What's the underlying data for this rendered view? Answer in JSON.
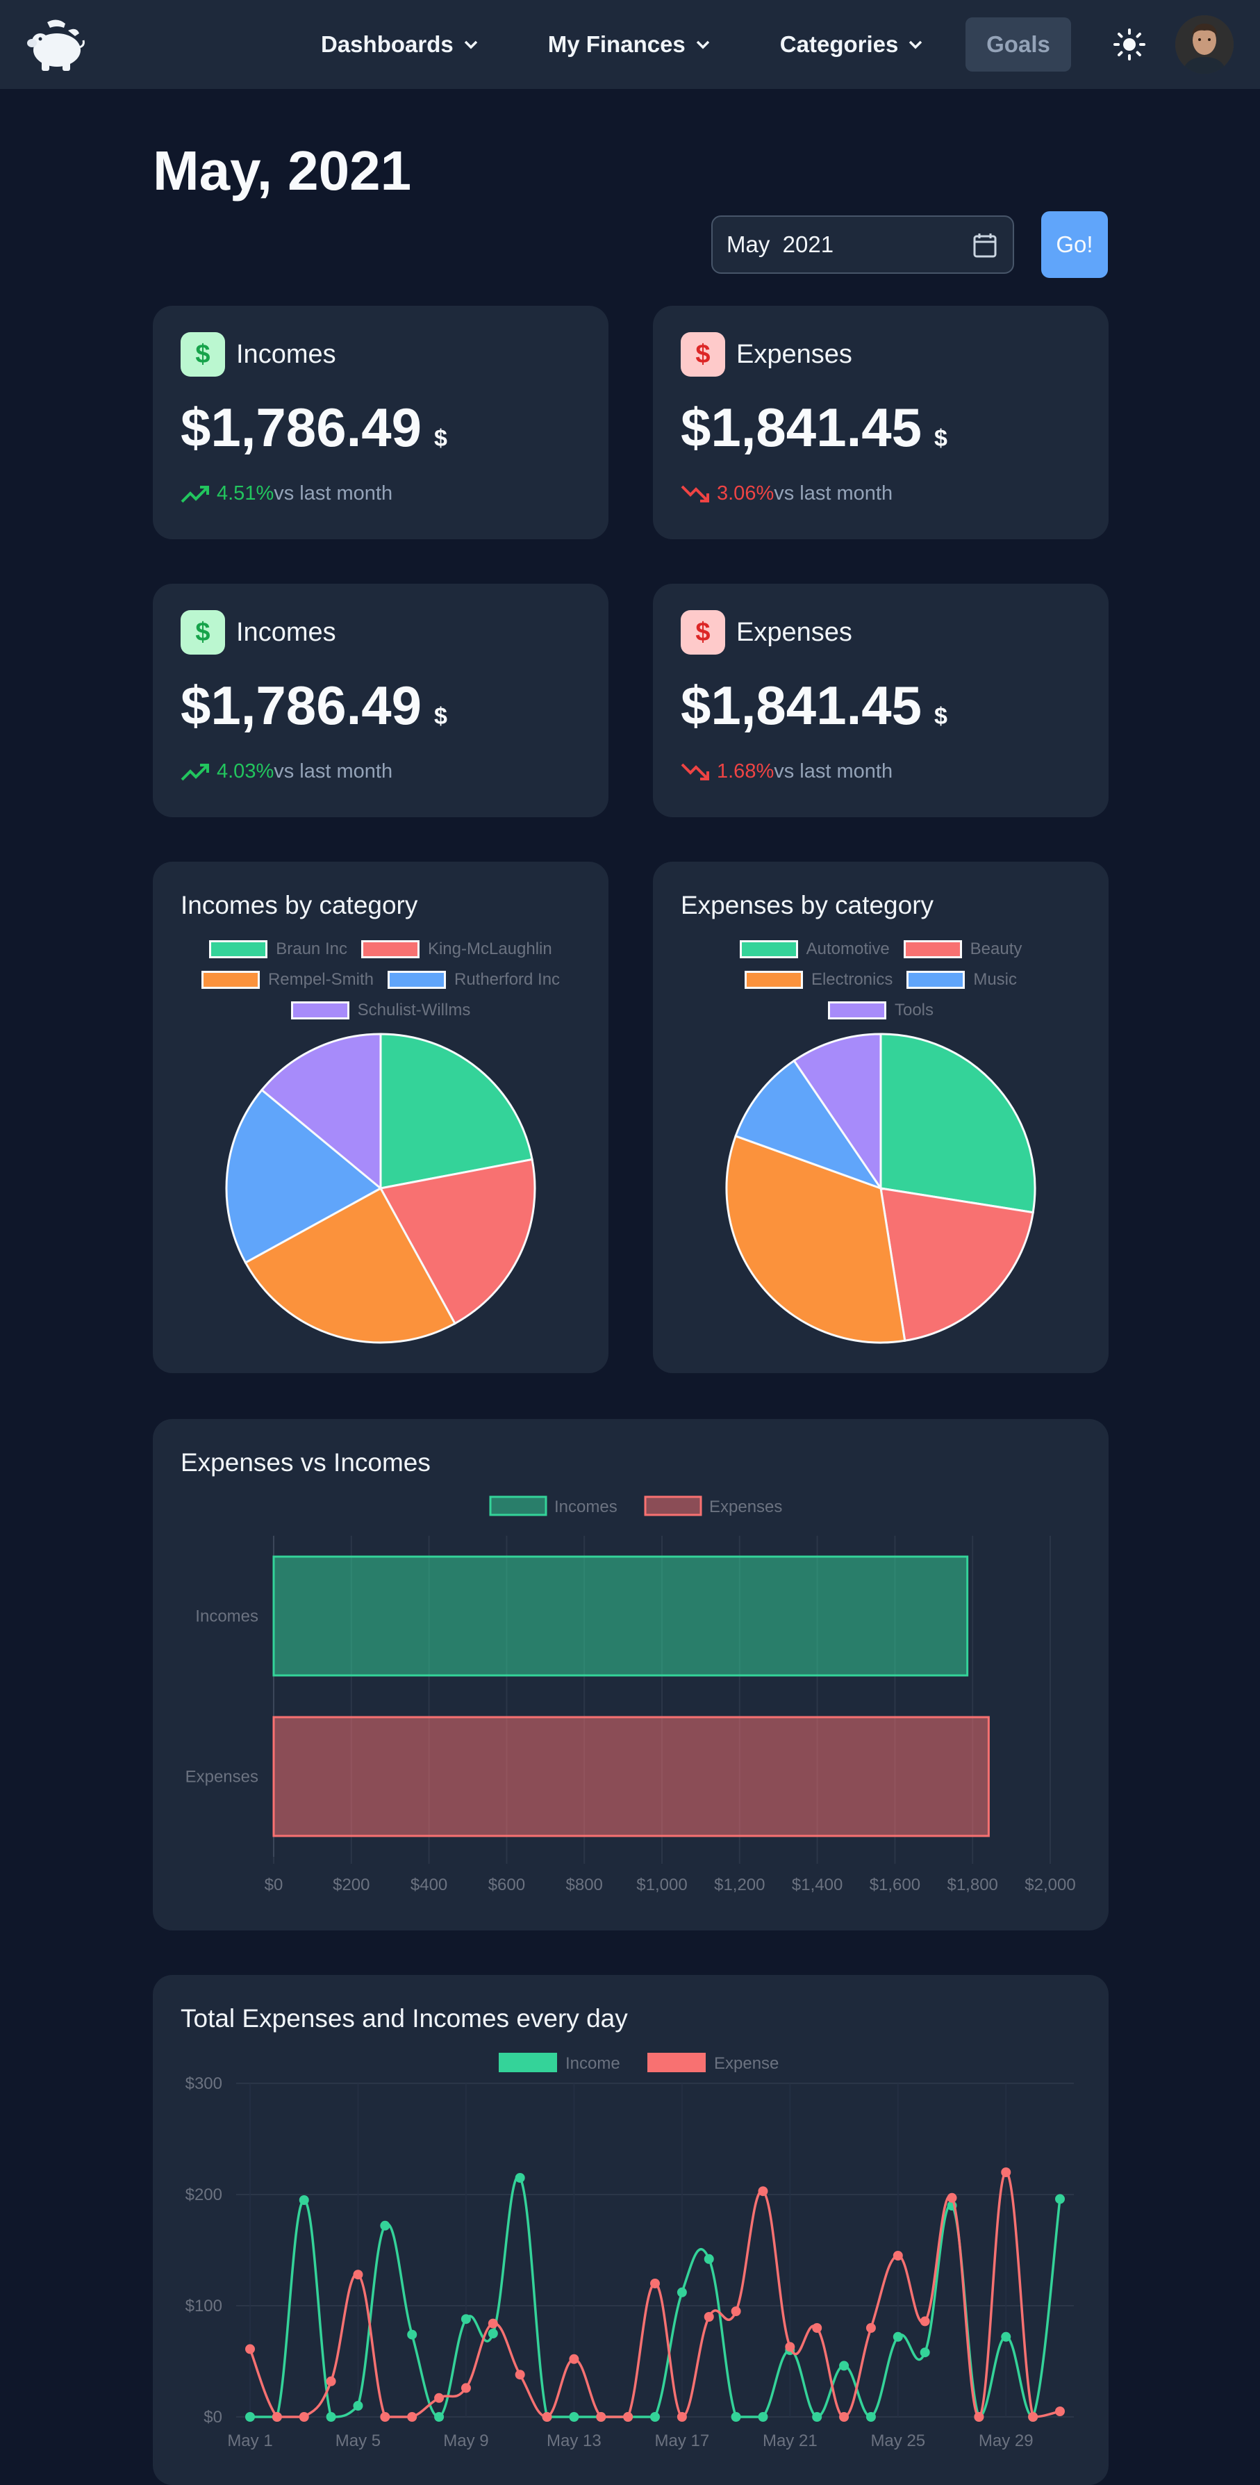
{
  "navbar": {
    "menu": [
      {
        "label": "Dashboards"
      },
      {
        "label": "My Finances"
      },
      {
        "label": "Categories"
      }
    ],
    "goals_label": "Goals"
  },
  "header": {
    "title": "May, 2021",
    "month_value": "May  2021",
    "go_label": "Go!"
  },
  "stats": [
    {
      "label": "Incomes",
      "value": "$1,786.49",
      "currency": "$",
      "change": "4.51%",
      "compare": "vs last month",
      "trend": "up",
      "color": "#22c55e"
    },
    {
      "label": "Expenses",
      "value": "$1,841.45",
      "currency": "$",
      "change": "3.06%",
      "compare": "vs last month",
      "trend": "down",
      "color": "#ef4444"
    },
    {
      "label": "Incomes",
      "value": "$1,786.49",
      "currency": "$",
      "change": "4.03%",
      "compare": "vs last month",
      "trend": "up",
      "color": "#22c55e"
    },
    {
      "label": "Expenses",
      "value": "$1,841.45",
      "currency": "$",
      "change": "1.68%",
      "compare": "vs last month",
      "trend": "down",
      "color": "#ef4444"
    }
  ],
  "chart_data": [
    {
      "type": "pie",
      "title": "Incomes by category",
      "labels": [
        "Braun Inc",
        "King-McLaughlin",
        "Rempel-Smith",
        "Rutherford Inc",
        "Schulist-Willms"
      ],
      "values": [
        22,
        20,
        25,
        19,
        14
      ],
      "colors": [
        "#34d399",
        "#f87171",
        "#fb923c",
        "#60a5fa",
        "#a78bfa"
      ],
      "legend": "top"
    },
    {
      "type": "pie",
      "title": "Expenses by category",
      "labels": [
        "Automotive",
        "Beauty",
        "Electronics",
        "Music",
        "Tools"
      ],
      "values": [
        27.5,
        20,
        33,
        10,
        9.5
      ],
      "colors": [
        "#34d399",
        "#f87171",
        "#fb923c",
        "#60a5fa",
        "#a78bfa"
      ],
      "legend": "top"
    },
    {
      "type": "bar",
      "orientation": "horizontal",
      "title": "Expenses vs Incomes",
      "categories": [
        "Incomes",
        "Expenses"
      ],
      "series": [
        {
          "name": "Incomes",
          "values": [
            1786.49,
            null
          ],
          "color": "#34d399"
        },
        {
          "name": "Expenses",
          "values": [
            null,
            1841.45
          ],
          "color": "#f87171"
        }
      ],
      "xlim": [
        0,
        2000
      ],
      "xticks": [
        "$0",
        "$200",
        "$400",
        "$600",
        "$800",
        "$1,000",
        "$1,200",
        "$1,400",
        "$1,600",
        "$1,800",
        "$2,000"
      ],
      "grid": true,
      "legend": "top"
    },
    {
      "type": "line",
      "title": "Total Expenses and Incomes every day",
      "x": [
        1,
        2,
        3,
        4,
        5,
        6,
        7,
        8,
        9,
        10,
        11,
        12,
        13,
        14,
        15,
        16,
        17,
        18,
        19,
        20,
        21,
        22,
        23,
        24,
        25,
        26,
        27,
        28,
        29,
        30,
        31
      ],
      "xticks": [
        {
          "day": 1,
          "label": "May 1"
        },
        {
          "day": 5,
          "label": "May 5"
        },
        {
          "day": 9,
          "label": "May 9"
        },
        {
          "day": 13,
          "label": "May 13"
        },
        {
          "day": 17,
          "label": "May 17"
        },
        {
          "day": 21,
          "label": "May 21"
        },
        {
          "day": 25,
          "label": "May 25"
        },
        {
          "day": 29,
          "label": "May 29"
        }
      ],
      "ylim": [
        0,
        300
      ],
      "yticks": [
        "$0",
        "$100",
        "$200",
        "$300"
      ],
      "series": [
        {
          "name": "Income",
          "color": "#34d399",
          "values": [
            0,
            0,
            195,
            0,
            10,
            172,
            74,
            0,
            88,
            75,
            215,
            0,
            0,
            0,
            0,
            0,
            112,
            142,
            0,
            0,
            60,
            0,
            46,
            0,
            72,
            58,
            190,
            0,
            72,
            0,
            196
          ]
        },
        {
          "name": "Expense",
          "color": "#f87171",
          "values": [
            61,
            0,
            0,
            32,
            128,
            0,
            0,
            17,
            26,
            84,
            38,
            0,
            52,
            0,
            0,
            120,
            0,
            90,
            95,
            203,
            63,
            80,
            0,
            80,
            145,
            86,
            197,
            0,
            220,
            0,
            5
          ]
        }
      ],
      "grid": true,
      "legend": "top"
    }
  ]
}
